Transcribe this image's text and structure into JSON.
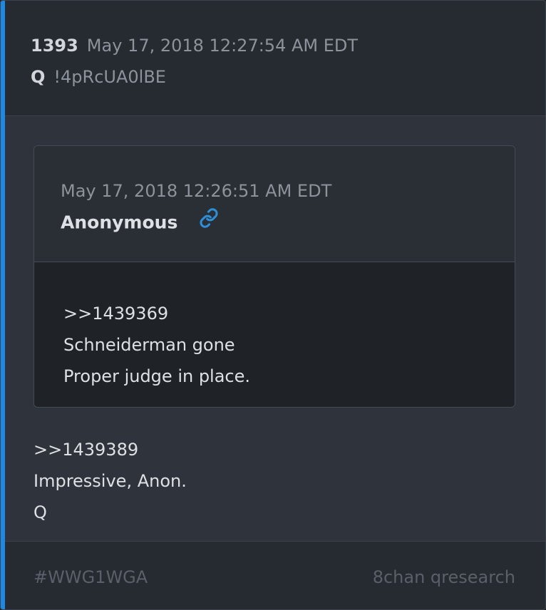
{
  "post": {
    "number": "1393",
    "date": "May 17, 2018 12:27:54 AM EDT",
    "author": "Q",
    "tripcode": "!4pRcUA0lBE"
  },
  "quoted_post": {
    "date": "May 17, 2018 12:26:51 AM EDT",
    "author": "Anonymous",
    "link_icon": "link-icon",
    "lines": [
      ">>1439369",
      "Schneiderman gone",
      "Proper judge in place."
    ]
  },
  "body": {
    "lines": [
      ">>1439389",
      "Impressive, Anon.",
      "Q"
    ]
  },
  "footer": {
    "hashtag": "#WWG1WGA",
    "source": "8chan qresearch"
  },
  "colors": {
    "accent": "#1e88e5",
    "link": "#2e8fd8"
  }
}
